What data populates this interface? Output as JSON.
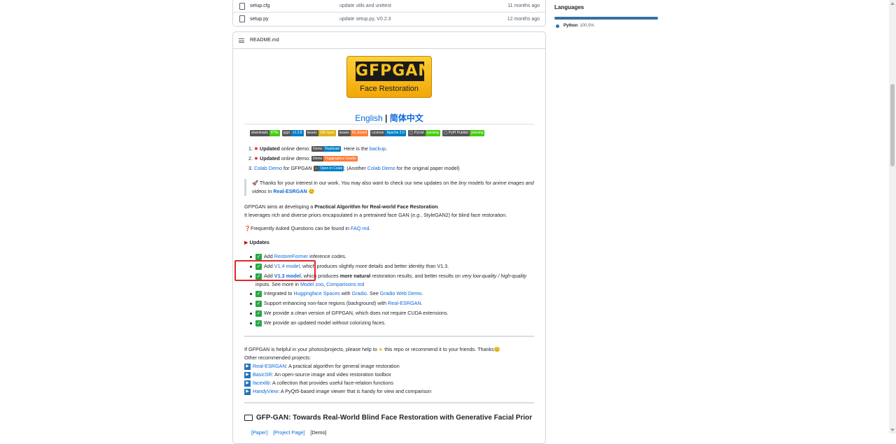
{
  "files": [
    {
      "name": "setup.cfg",
      "message": "update utils and unittest",
      "time": "11 months ago"
    },
    {
      "name": "setup.py",
      "message": "update setup.py, V0.2.3",
      "time": "12 months ago"
    }
  ],
  "sidebar": {
    "languages_title": "Languages",
    "lang_name": "Python",
    "lang_pct": "100.0%"
  },
  "readme": {
    "filename": "README.md",
    "logo_main": "GFPGAN",
    "logo_sub": "Face Restoration",
    "lang_english": "English",
    "lang_sep": " | ",
    "lang_chinese": "简体中文",
    "badges": [
      {
        "l": "downloads",
        "r": "875k",
        "c": "#4c1"
      },
      {
        "l": "pypi",
        "r": "v1.3.8",
        "c": "#007ec6"
      },
      {
        "l": "issues",
        "r": "158 open",
        "c": "#dfb317"
      },
      {
        "l": "issues",
        "r": "91 closed",
        "c": "#fe7d37"
      },
      {
        "l": "License",
        "r": "Apache 2.0",
        "c": "#007ec6"
      },
      {
        "l": "◯ PyLint",
        "r": "passing",
        "c": "#4c1"
      },
      {
        "l": "◯ PyPI Publish",
        "r": "passing",
        "c": "#4c1"
      }
    ],
    "list": {
      "i1_num": "1.",
      "i1_updated": "Updated",
      "i1_text1": " online demo: ",
      "i1_demo_l": "Demo",
      "i1_demo_r": "Replicate",
      "i1_text2": ". Here is the ",
      "i1_link": "backup",
      "i1_text3": ".",
      "i2_num": "2.",
      "i2_updated": "Updated",
      "i2_text1": " online demo: ",
      "i2_demo_l": "Demo",
      "i2_demo_r": "Huggingface Gradio",
      "i3_num": "3.",
      "i3_link": "Colab Demo",
      "i3_text1": " for GFPGAN ",
      "i3_badge": "Open in Colab",
      "i3_text2": "; (Another ",
      "i3_link2": "Colab Demo",
      "i3_text3": " for the original paper model)"
    },
    "quote": {
      "t1": "Thanks for your interest in our work. You may also want to check our new updates on the ",
      "t1i": "tiny models",
      "t2": " for ",
      "t2i": "anime images and videos",
      "t3": " in ",
      "link": "Real-ESRGAN"
    },
    "about": {
      "t1": "GFPGAN aims at developing a ",
      "b": "Practical Algorithm for Real-world Face Restoration",
      "t2": ".",
      "line2": "It leverages rich and diverse priors encapsulated in a pretrained face GAN (",
      "eg": "e.g.",
      "line2b": ", StyleGAN2) for blind face restoration."
    },
    "faq": {
      "t": "Frequently Asked Questions can be found in ",
      "link": "FAQ.md",
      "end": "."
    },
    "updates_title": "Updates",
    "updates": {
      "u1a": "Add ",
      "u1l": "RestoreFormer",
      "u1b": " inference codes.",
      "u2a": "Add ",
      "u2l": "V1.4 model",
      "u2b": ", which produces slightly more details and better identity than V1.3.",
      "u3a": "Add ",
      "u3l": "V1.3 model",
      "u3b": ", which produces ",
      "u3bold": "more natural",
      "u3c": " restoration results, and better results on ",
      "u3i": "very low-quality / high-quality",
      "u3d": " inputs. See more in ",
      "u3l2": "Model zoo",
      "u3e": ", ",
      "u3l3": "Comparisons.md",
      "u4a": "Integrated to ",
      "u4l": "Huggingface Spaces",
      "u4b": " with ",
      "u4l2": "Gradio",
      "u4c": ". See ",
      "u4l3": "Gradio Web Demo",
      "u4d": ".",
      "u5a": "Support enhancing non-face regions (background) with ",
      "u5l": "Real-ESRGAN",
      "u5b": ".",
      "u6a": "We provide a ",
      "u6i": "clean",
      "u6b": " version of GFPGAN, which does not require CUDA extensions.",
      "u7": "We provide an updated model without colorizing faces."
    },
    "helpful": {
      "t1": "If GFPGAN is helpful in your photos/projects, please help to ",
      "t2": " this repo or recommend it to your friends. Thanks",
      "t3": "Other recommended projects:"
    },
    "projects": [
      {
        "name": "Real-ESRGAN",
        "desc": ": A practical algorithm for general image restoration"
      },
      {
        "name": "BasicSR",
        "desc": ": An open-source image and video restoration toolbox"
      },
      {
        "name": "facexlib",
        "desc": ": A collection that provides useful face-relation functions"
      },
      {
        "name": "HandyView",
        "desc": ": A PyQt5-based image viewer that is handy for view and comparison"
      }
    ],
    "paper_title": "GFP-GAN: Towards Real-World Blind Face Restoration with Generative Facial Prior",
    "paper_links": {
      "a": "[Paper]",
      "b": "[Project Page]",
      "c": "[Demo]"
    }
  }
}
